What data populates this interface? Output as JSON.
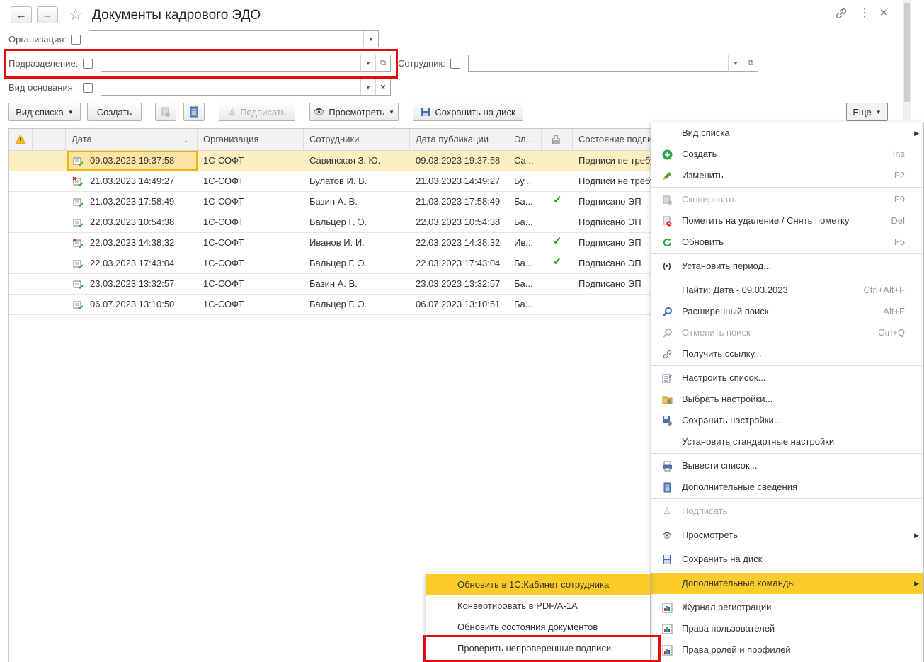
{
  "window": {
    "title": "Документы кадрового ЭДО",
    "back_icon": "←",
    "forward_icon": "→"
  },
  "filters": {
    "organization_label": "Организация:",
    "subdivision_label": "Подразделение:",
    "employee_label": "Сотрудник:",
    "basis_label": "Вид основания:"
  },
  "toolbar": {
    "list_view": "Вид списка",
    "create": "Создать",
    "sign": "Подписать",
    "view": "Просмотреть",
    "save_to_disk": "Сохранить на диск",
    "more": "Еще"
  },
  "table": {
    "columns": [
      "Дата",
      "Организация",
      "Сотрудники",
      "Дата публикации",
      "Эл...",
      "Состояние подпи"
    ],
    "rows": [
      {
        "date": "09.03.2023 19:37:58",
        "org": "1С-СОФТ",
        "emp": "Савинская З. Ю.",
        "pub": "09.03.2023 19:37:58",
        "el": "Са...",
        "signed": false,
        "state": "Подписи не требу",
        "icon": "doc-ok",
        "selected": true
      },
      {
        "date": "21.03.2023 14:49:27",
        "org": "1С-СОФТ",
        "emp": "Булатов И. В.",
        "pub": "21.03.2023 14:49:27",
        "el": "Бу...",
        "signed": false,
        "state": "Подписи не требу",
        "icon": "doc-deleted",
        "selected": false
      },
      {
        "date": "21.03.2023 17:58:49",
        "org": "1С-СОФТ",
        "emp": "Базин А. В.",
        "pub": "21.03.2023 17:58:49",
        "el": "Ба...",
        "signed": true,
        "state": "Подписано ЭП",
        "icon": "doc-ok",
        "selected": false
      },
      {
        "date": "22.03.2023 10:54:38",
        "org": "1С-СОФТ",
        "emp": "Бальцер Г. Э.",
        "pub": "22.03.2023 10:54:38",
        "el": "Ба...",
        "signed": false,
        "state": "Подписано ЭП",
        "icon": "doc-ok",
        "selected": false
      },
      {
        "date": "22.03.2023 14:38:32",
        "org": "1С-СОФТ",
        "emp": "Иванов И. И.",
        "pub": "22.03.2023 14:38:32",
        "el": "Ив...",
        "signed": true,
        "state": "Подписано ЭП",
        "icon": "doc-deleted",
        "selected": false
      },
      {
        "date": "22.03.2023 17:43:04",
        "org": "1С-СОФТ",
        "emp": "Бальцер Г. Э.",
        "pub": "22.03.2023 17:43:04",
        "el": "Ба...",
        "signed": true,
        "state": "Подписано ЭП",
        "icon": "doc-ok",
        "selected": false
      },
      {
        "date": "23.03.2023 13:32:57",
        "org": "1С-СОФТ",
        "emp": "Базин А. В.",
        "pub": "23.03.2023 13:32:57",
        "el": "Ба...",
        "signed": false,
        "state": "Подписано ЭП",
        "icon": "doc-ok",
        "selected": false
      },
      {
        "date": "06.07.2023 13:10:50",
        "org": "1С-СОФТ",
        "emp": "Бальцер Г. Э.",
        "pub": "06.07.2023 13:10:51",
        "el": "Ба...",
        "signed": false,
        "state": "",
        "icon": "doc-ok",
        "selected": false
      }
    ]
  },
  "menu": {
    "items": [
      {
        "label": "Вид списка",
        "shortcut": "",
        "submenu": true,
        "disabled": false,
        "icon": "none"
      },
      {
        "label": "Создать",
        "shortcut": "Ins",
        "submenu": false,
        "disabled": false,
        "icon": "plus-circle-icon"
      },
      {
        "label": "Изменить",
        "shortcut": "F2",
        "submenu": false,
        "disabled": false,
        "icon": "pencil-icon"
      },
      {
        "label": "Скопировать",
        "shortcut": "F9",
        "submenu": false,
        "disabled": true,
        "icon": "copy-icon"
      },
      {
        "label": "Пометить на удаление / Снять пометку",
        "shortcut": "Del",
        "submenu": false,
        "disabled": false,
        "icon": "delete-mark-icon"
      },
      {
        "label": "Обновить",
        "shortcut": "F5",
        "submenu": false,
        "disabled": false,
        "icon": "refresh-icon"
      },
      {
        "label": "Установить период...",
        "shortcut": "",
        "submenu": false,
        "disabled": false,
        "icon": "period-icon"
      },
      {
        "label": "Найти: Дата - 09.03.2023",
        "shortcut": "Ctrl+Alt+F",
        "submenu": false,
        "disabled": false,
        "icon": "none"
      },
      {
        "label": "Расширенный поиск",
        "shortcut": "Alt+F",
        "submenu": false,
        "disabled": false,
        "icon": "search-icon"
      },
      {
        "label": "Отменить поиск",
        "shortcut": "Ctrl+Q",
        "submenu": false,
        "disabled": true,
        "icon": "cancel-search-icon"
      },
      {
        "label": "Получить ссылку...",
        "shortcut": "",
        "submenu": false,
        "disabled": false,
        "icon": "link-icon"
      },
      {
        "label": "Настроить список...",
        "shortcut": "",
        "submenu": false,
        "disabled": false,
        "icon": "configure-list-icon"
      },
      {
        "label": "Выбрать настройки...",
        "shortcut": "",
        "submenu": false,
        "disabled": false,
        "icon": "choose-settings-icon"
      },
      {
        "label": "Сохранить настройки...",
        "shortcut": "",
        "submenu": false,
        "disabled": false,
        "icon": "save-settings-icon"
      },
      {
        "label": "Установить стандартные настройки",
        "shortcut": "",
        "submenu": false,
        "disabled": false,
        "icon": "none"
      },
      {
        "label": "Вывести список...",
        "shortcut": "",
        "submenu": false,
        "disabled": false,
        "icon": "print-list-icon"
      },
      {
        "label": "Дополнительные сведения",
        "shortcut": "",
        "submenu": false,
        "disabled": false,
        "icon": "details-icon"
      },
      {
        "label": "Подписать",
        "shortcut": "",
        "submenu": false,
        "disabled": true,
        "icon": "sign-icon"
      },
      {
        "label": "Просмотреть",
        "shortcut": "",
        "submenu": true,
        "disabled": false,
        "icon": "eye-icon"
      },
      {
        "label": "Сохранить на диск",
        "shortcut": "",
        "submenu": false,
        "disabled": false,
        "icon": "floppy-icon"
      },
      {
        "label": "Дополнительные команды",
        "shortcut": "",
        "submenu": true,
        "disabled": false,
        "icon": "none"
      },
      {
        "label": "Журнал регистрации",
        "shortcut": "",
        "submenu": false,
        "disabled": false,
        "icon": "report-icon"
      },
      {
        "label": "Права пользователей",
        "shortcut": "",
        "submenu": false,
        "disabled": false,
        "icon": "report-icon"
      },
      {
        "label": "Права ролей и профилей",
        "shortcut": "",
        "submenu": false,
        "disabled": false,
        "icon": "report-icon"
      }
    ]
  },
  "submenu": {
    "items": [
      "Обновить в 1С:Кабинет сотрудника",
      "Конвертировать в PDF/A-1A",
      "Обновить состояния документов",
      "Проверить непроверенные подписи"
    ]
  },
  "colors": {
    "highlight": "#fbcc29",
    "selected_row": "#fcf0c3",
    "annotation": "#e10d0d",
    "check": "#1aa31a"
  }
}
